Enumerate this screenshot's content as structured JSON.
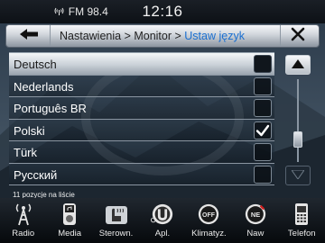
{
  "status": {
    "radio": "FM 98.4",
    "time": "12:16"
  },
  "header": {
    "crumb_1": "Nastawienia",
    "sep_1": " > ",
    "crumb_2": "Monitor",
    "sep_2": " > ",
    "crumb_current": "Ustaw język",
    "back_icon": "back-arrow-icon",
    "close_icon": "close-icon"
  },
  "languages": [
    {
      "label": "Deutsch",
      "checked": false,
      "selected": true
    },
    {
      "label": "Nederlands",
      "checked": false,
      "selected": false
    },
    {
      "label": "Português BR",
      "checked": false,
      "selected": false
    },
    {
      "label": "Polski",
      "checked": true,
      "selected": false
    },
    {
      "label": "Türk",
      "checked": false,
      "selected": false
    },
    {
      "label": "Русский",
      "checked": false,
      "selected": false
    }
  ],
  "list_info": "11 pozycje na liście",
  "scroll": {
    "position_fraction": 0.78
  },
  "nav": [
    {
      "label": "Radio",
      "icon": "radio-tower-icon"
    },
    {
      "label": "Media",
      "icon": "media-player-icon"
    },
    {
      "label": "Sterown.",
      "icon": "seat-heat-icon"
    },
    {
      "label": "Apl.",
      "icon": "apps-icon",
      "badge": "1..."
    },
    {
      "label": "Klimatyz.",
      "icon": "climate-off-icon",
      "badge_text": "OFF"
    },
    {
      "label": "Naw",
      "icon": "navigation-icon",
      "badge_text": "NE"
    },
    {
      "label": "Telefon",
      "icon": "phone-icon"
    }
  ],
  "colors": {
    "accent": "#1a6fd0",
    "header_light": "#f6f7f9",
    "list_row": "#283746"
  }
}
